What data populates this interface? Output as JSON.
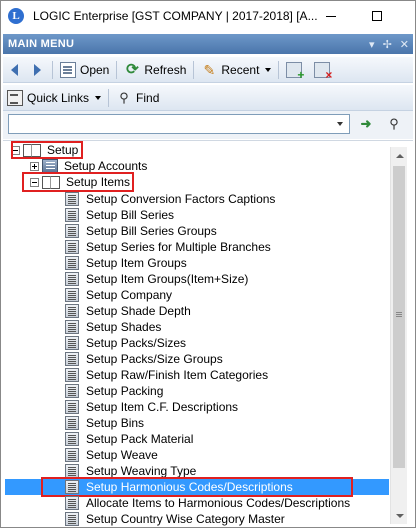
{
  "window": {
    "logo_letter": "L",
    "title": "LOGIC Enterprise [GST COMPANY  | 2017-2018] [A...",
    "minimize_icon": "minimize-icon",
    "maximize_icon": "maximize-icon"
  },
  "panel": {
    "title": "MAIN MENU",
    "dropdown_glyph": "▾",
    "pin_glyph": "✢",
    "close_glyph": "✕"
  },
  "toolbar": {
    "open_label": "Open",
    "refresh_label": "Refresh",
    "recent_label": "Recent",
    "quick_links_label": "Quick Links",
    "find_label": "Find"
  },
  "search": {
    "value": "",
    "placeholder": ""
  },
  "tree": {
    "root": {
      "label": "Setup",
      "expanded": true
    },
    "accounts": {
      "label": "Setup Accounts",
      "expanded": false
    },
    "items_group": {
      "label": "Setup Items",
      "expanded": true
    },
    "items": [
      {
        "label": "Setup Conversion Factors Captions"
      },
      {
        "label": "Setup Bill Series"
      },
      {
        "label": "Setup Bill Series Groups"
      },
      {
        "label": "Setup Series for Multiple Branches"
      },
      {
        "label": "Setup Item Groups"
      },
      {
        "label": "Setup Item Groups(Item+Size)"
      },
      {
        "label": "Setup Company"
      },
      {
        "label": "Setup Shade Depth"
      },
      {
        "label": "Setup Shades"
      },
      {
        "label": "Setup Packs/Sizes"
      },
      {
        "label": "Setup Packs/Size Groups"
      },
      {
        "label": "Setup Raw/Finish Item Categories"
      },
      {
        "label": "Setup Packing"
      },
      {
        "label": "Setup Item C.F. Descriptions"
      },
      {
        "label": "Setup Bins"
      },
      {
        "label": "Setup Pack Material"
      },
      {
        "label": "Setup Weave"
      },
      {
        "label": "Setup Weaving Type"
      },
      {
        "label": "Setup Harmonious Codes/Descriptions",
        "selected": true
      },
      {
        "label": "Allocate Items to Harmonious Codes/Descriptions"
      },
      {
        "label": "Setup Country Wise Category Master"
      }
    ]
  },
  "colors": {
    "selection": "#3399ff",
    "highlight_box": "#e02020",
    "panel_header": "#5a83b8"
  }
}
